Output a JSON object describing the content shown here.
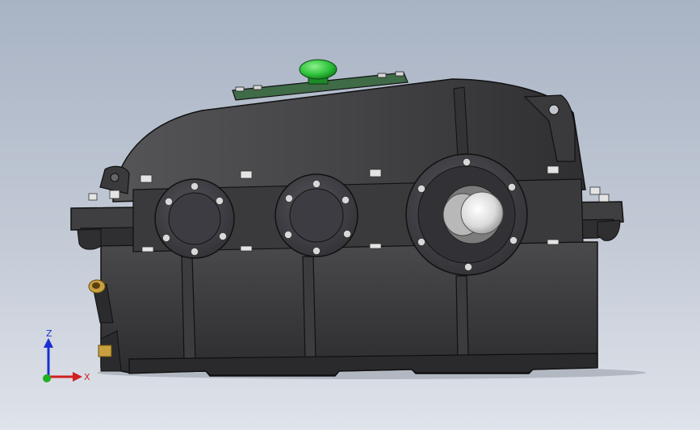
{
  "viewport": {
    "background_top": "#a8b3c4",
    "background_bottom": "#dfe3ea"
  },
  "model": {
    "subject": "gear-reducer-housing",
    "body_color": "#3a3a3c",
    "edge_color": "#111111",
    "cover_plate_color": "#3f6b47",
    "vent_cap_color": "#2fc33c",
    "shaft_color": "#e8e8e8",
    "fitting_color": "#c8a040"
  },
  "triad": {
    "z_label": "Z",
    "x_label": "X",
    "z_color": "#1a2fd0",
    "x_color": "#d02020",
    "y_color": "#20b020"
  }
}
